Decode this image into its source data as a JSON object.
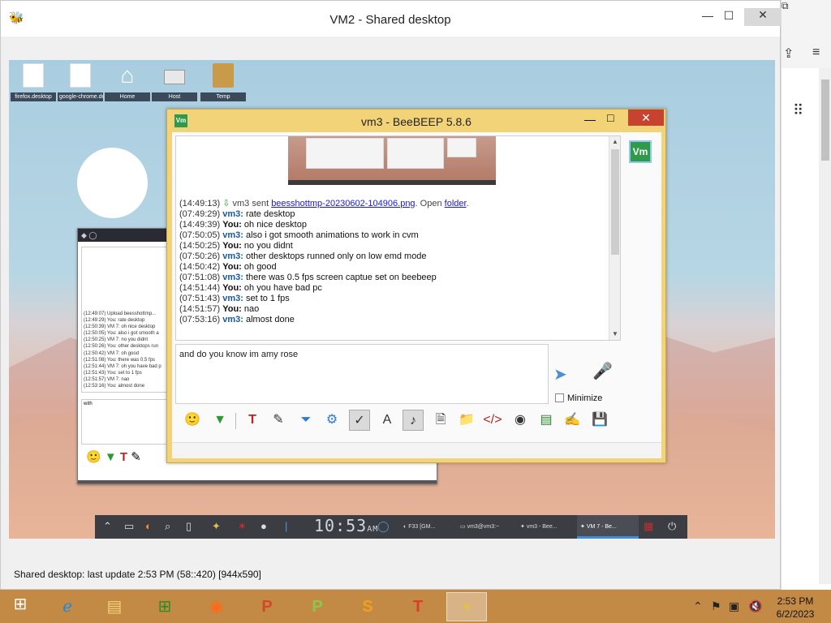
{
  "vm2": {
    "title": "VM2 - Shared desktop",
    "status": "Shared desktop: last update 2:53 PM (58::420) [944x590]"
  },
  "desktop_icons": [
    {
      "label": "firefox.desktop"
    },
    {
      "label": "google-chrome.desk..."
    },
    {
      "label": "Home"
    },
    {
      "label": "Host"
    },
    {
      "label": "Temp"
    }
  ],
  "bg_window": {
    "lines": [
      "(12:49:07) Upload beesshottmp...",
      "(12:49:29) You: rate desktop",
      "(12:50:39) VM 7: oh nice desktop",
      "(12:50:05) You: also i got smooth a",
      "(12:50:25) VM 7: no you didnt",
      "(12:50:26) You: other desktops run",
      "(12:50:42) VM 7: oh good",
      "(12:51:08) You: there was 0.5 fps",
      "(12:51:44) VM 7: oh you have bad p",
      "(12:51:43) You: set to 1 fps",
      "(12:51:57) VM 7: nao",
      "(12:53:16) You: almost done"
    ],
    "input_text": "with"
  },
  "beebeep": {
    "title": "vm3 - BeeBEEP 5.8.6",
    "file_msg": {
      "ts": "(14:49:13)",
      "text_before": "vm3 sent ",
      "link": "beesshottmp-20230602-104906.png",
      "text_after": ". Open ",
      "folder_link": "folder",
      "end": "."
    },
    "messages": [
      {
        "ts": "(07:49:29)",
        "who": "vm3:",
        "text": " rate desktop"
      },
      {
        "ts": "(14:49:39)",
        "who": "You:",
        "text": " oh nice desktop"
      },
      {
        "ts": "(07:50:05)",
        "who": "vm3:",
        "text": " also i got smooth animations to work in cvm"
      },
      {
        "ts": "(14:50:25)",
        "who": "You:",
        "text": " no you didnt"
      },
      {
        "ts": "(07:50:26)",
        "who": "vm3:",
        "text": " other desktops runned only on low emd mode"
      },
      {
        "ts": "(14:50:42)",
        "who": "You:",
        "text": " oh good"
      },
      {
        "ts": "(07:51:08)",
        "who": "vm3:",
        "text": " there was 0.5 fps screen captue set on beebeep"
      },
      {
        "ts": "(14:51:44)",
        "who": "You:",
        "text": " oh you have bad pc"
      },
      {
        "ts": "(07:51:43)",
        "who": "vm3:",
        "text": " set to 1 fps"
      },
      {
        "ts": "(14:51:57)",
        "who": "You:",
        "text": " nao"
      },
      {
        "ts": "(07:53:16)",
        "who": "vm3:",
        "text": " almost done"
      }
    ],
    "input_text": "and do you know im amy rose",
    "minimize_label": "Minimize",
    "avatar_text": "Vm",
    "icon_text": "Vm"
  },
  "dock": {
    "clock": "10:53",
    "ampm": "AM",
    "tasks": [
      {
        "label": "F33 [GM..."
      },
      {
        "label": "vm3@vm3:~"
      },
      {
        "label": "vm3 - Bee..."
      },
      {
        "label": "VM 7 - Be..."
      }
    ]
  },
  "taskbar": {
    "time": "2:53 PM",
    "date": "6/2/2023"
  }
}
